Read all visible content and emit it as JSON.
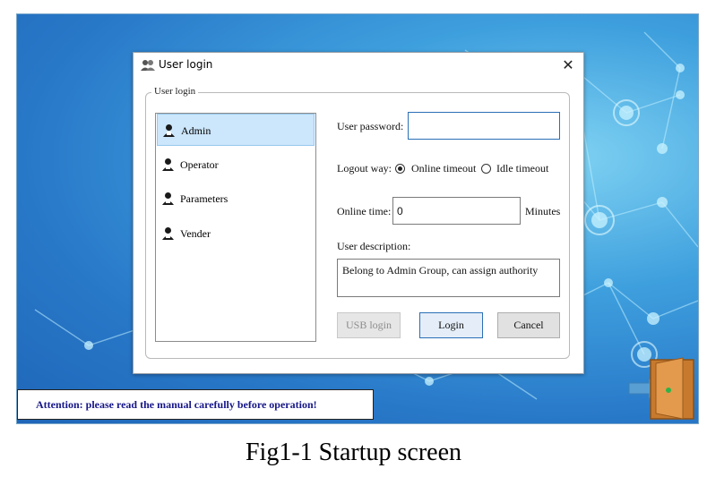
{
  "dialog": {
    "title": "User login",
    "close_glyph": "✕",
    "group_label": "User login",
    "users": [
      {
        "label": "Admin",
        "selected": true
      },
      {
        "label": "Operator",
        "selected": false
      },
      {
        "label": "Parameters",
        "selected": false
      },
      {
        "label": "Vender",
        "selected": false
      }
    ],
    "password_label": "User password:",
    "password_value": "",
    "logout_label": "Logout way:",
    "logout_options": [
      {
        "label": "Online timeout",
        "checked": true
      },
      {
        "label": "Idle timeout",
        "checked": false
      }
    ],
    "online_time_label": "Online time:",
    "online_time_value": "0",
    "online_time_unit": "Minutes",
    "description_label": "User description:",
    "description_value": "Belong to Admin Group, can assign authority",
    "buttons": {
      "usb": "USB login",
      "login": "Login",
      "cancel": "Cancel"
    }
  },
  "attention_text": "Attention: please read the manual carefully before operation!",
  "caption": "Fig1-1 Startup screen",
  "colors": {
    "desktop_blue": "#2a7bd0",
    "selection": "#cce6fb",
    "focus_border": "#2a6fb5",
    "attention_text": "#16168a",
    "door": "#d98a3c"
  },
  "icons": {
    "title": "users-icon",
    "user": "user-badge-icon",
    "exit": "exit-door-icon"
  }
}
